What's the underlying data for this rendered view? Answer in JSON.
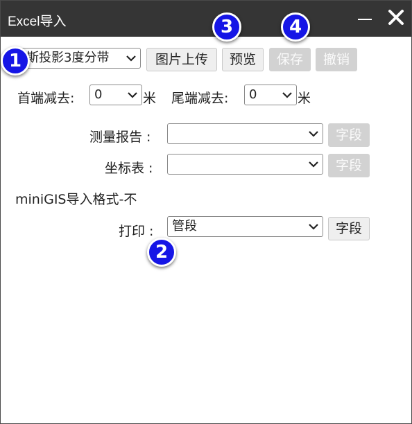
{
  "window": {
    "title": "Excel导入",
    "minimize_icon": "minimize-icon",
    "close_icon": "close-icon"
  },
  "toolbar": {
    "projection_select": {
      "value": "高斯投影3度分带",
      "visible_text": "斯投影3度分带"
    },
    "upload_image_label": "图片上传",
    "preview_label": "预览",
    "save_label": "保存",
    "undo_label": "撤销"
  },
  "reduction": {
    "start_label": "首端减去:",
    "start_value": "0",
    "start_unit": "米",
    "end_label": "尾端减去:",
    "end_value": "0",
    "end_unit": "米"
  },
  "form": {
    "survey_report_label": "测量报告 :",
    "survey_report_value": "",
    "coordinate_table_label": "坐标表 :",
    "coordinate_table_value": "",
    "field_label": "字段",
    "minigis_text": "miniGIS导入格式-不",
    "print_label": "打印 :",
    "print_value": "管段"
  },
  "callouts": [
    "1",
    "2",
    "3",
    "4"
  ],
  "colors": {
    "titlebar": "#353535",
    "callout_badge": "#1515e6",
    "disabled_button": "#d2d2d2"
  }
}
